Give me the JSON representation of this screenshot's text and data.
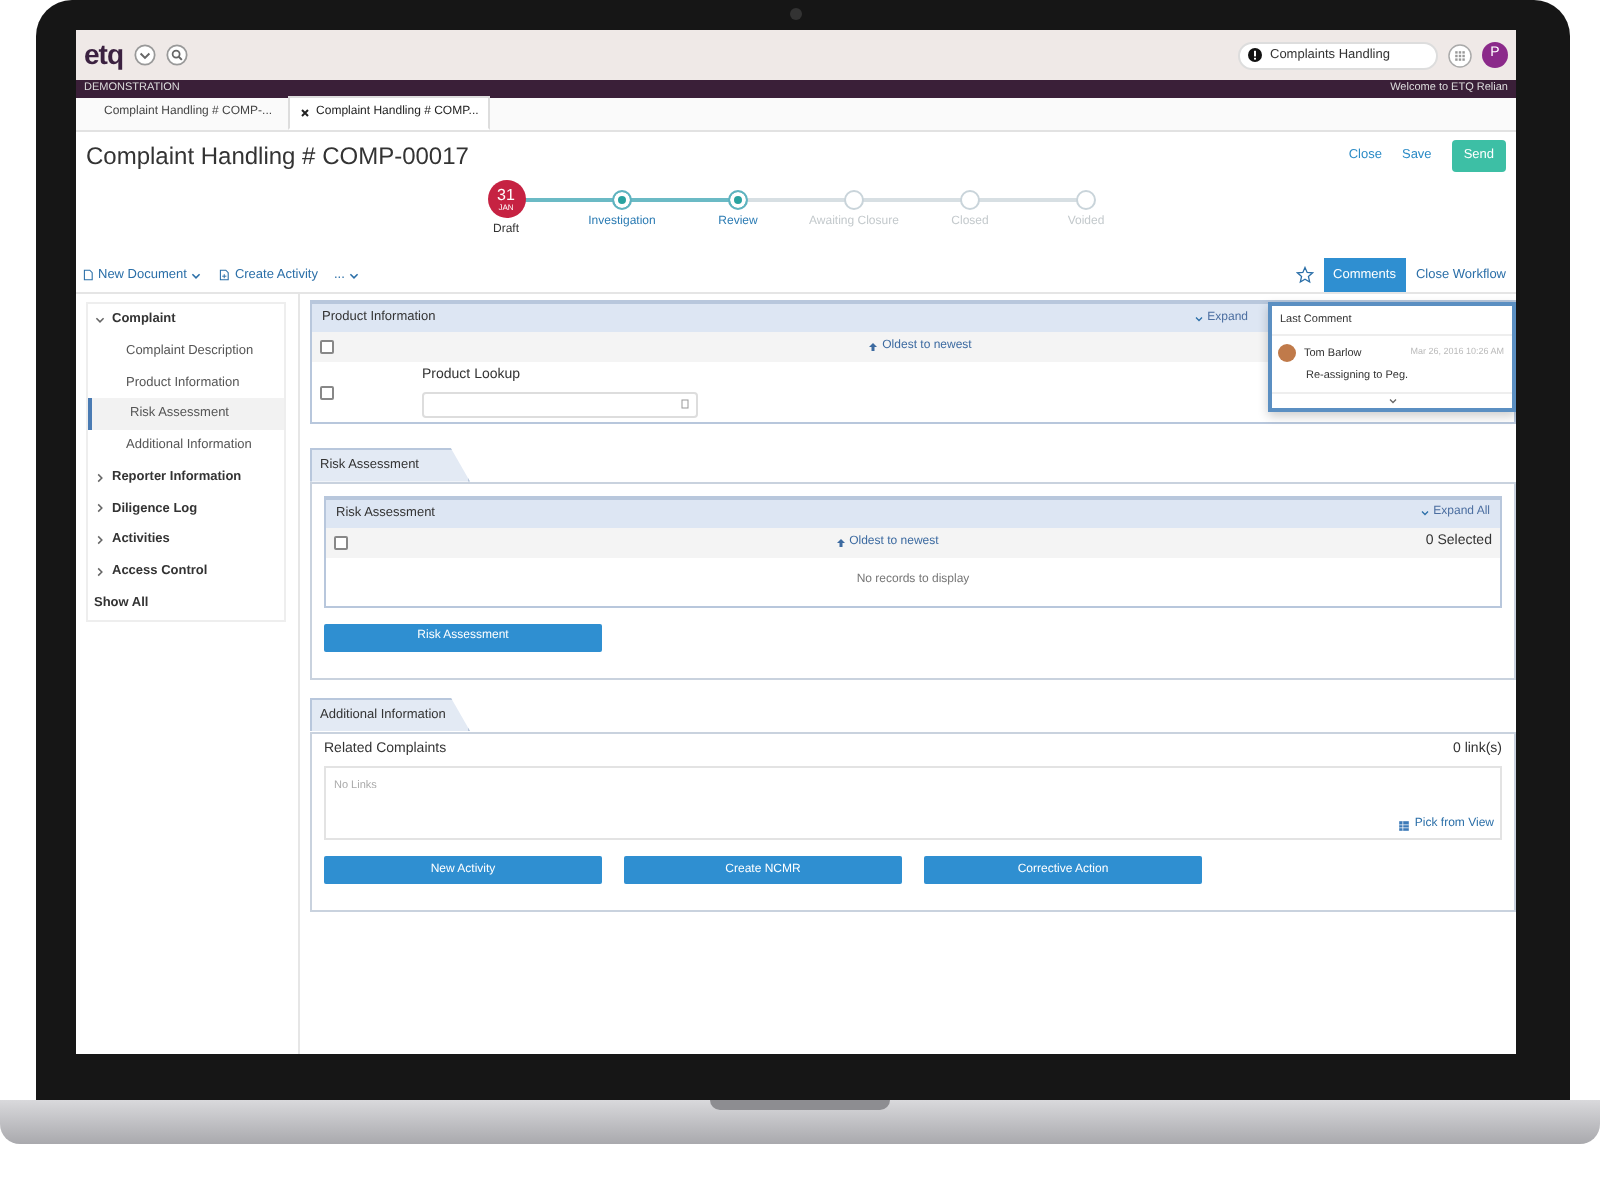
{
  "topbar": {
    "logo": "etq",
    "search": {
      "value": "Complaints Handling"
    },
    "user_initial": "P"
  },
  "banner": {
    "left": "DEMONSTRATION",
    "right": "Welcome to ETQ Relian"
  },
  "tabs": [
    {
      "label": "Complaint Handling # COMP-...",
      "selected": false,
      "closable": false
    },
    {
      "label": "Complaint Handling # COMP...",
      "selected": true,
      "closable": true
    }
  ],
  "title": "Complaint Handling # COMP-00017",
  "actions": [
    {
      "label": "Close",
      "kind": "link"
    },
    {
      "label": "Save",
      "kind": "link"
    },
    {
      "label": "Send",
      "kind": "primary"
    }
  ],
  "workflow": [
    {
      "label": "Draft",
      "kind": "current",
      "day": "31",
      "month": "JAN"
    },
    {
      "label": "Investigation",
      "kind": "done"
    },
    {
      "label": "Review",
      "kind": "done"
    },
    {
      "label": "Awaiting Closure",
      "kind": "pending"
    },
    {
      "label": "Closed",
      "kind": "pending"
    },
    {
      "label": "Voided",
      "kind": "pending"
    }
  ],
  "toolbar": {
    "left": [
      {
        "label": "New Document",
        "kind": "dropdown"
      },
      {
        "label": "Create Activity",
        "kind": "plain"
      },
      {
        "label": "...",
        "kind": "more"
      }
    ],
    "favorite": false,
    "right": [
      {
        "label": "Comments",
        "selected": true
      },
      {
        "label": "Close Workflow",
        "selected": false
      }
    ]
  },
  "sidebar": {
    "items": [
      {
        "label": "Complaint",
        "expanded": true,
        "selected": false,
        "children": [
          {
            "label": "Complaint Description",
            "selected": false
          },
          {
            "label": "Product Information",
            "selected": false
          },
          {
            "label": "Risk Assessment",
            "selected": true
          },
          {
            "label": "Additional Information",
            "selected": false
          }
        ]
      },
      {
        "label": "Reporter Information",
        "expanded": false,
        "selected": false
      },
      {
        "label": "Diligence Log",
        "expanded": false,
        "selected": false
      },
      {
        "label": "Activities",
        "expanded": false,
        "selected": false
      },
      {
        "label": "Access Control",
        "expanded": false,
        "selected": false
      },
      {
        "label": "Show All",
        "selected": false
      }
    ]
  },
  "product_information": {
    "title": "Product Information",
    "expand": "Expand",
    "sort": "Oldest to newest",
    "rows": [
      {
        "checked": false
      },
      {
        "checked": false,
        "field_label": "Product Lookup"
      }
    ]
  },
  "risk_assessment": {
    "tab": "Risk Assessment",
    "grid": {
      "title": "Risk Assessment",
      "expand": "Expand All",
      "sort": "Oldest to newest",
      "selected_count": "0 Selected",
      "checked": false,
      "empty": "No records to display"
    },
    "button": "Risk Assessment"
  },
  "additional_information": {
    "tab": "Additional Information",
    "links": {
      "title": "Related Complaints",
      "count": "0 link(s)",
      "empty": "No Links",
      "pick": "Pick from View"
    },
    "buttons": [
      "New Activity",
      "Create NCMR",
      "Corrective Action"
    ]
  },
  "comments_popup": {
    "title": "Last Comment",
    "author": "Tom Barlow",
    "time": "Mar 26, 2016 10:26 AM",
    "text": "Re-assigning to Peg."
  }
}
